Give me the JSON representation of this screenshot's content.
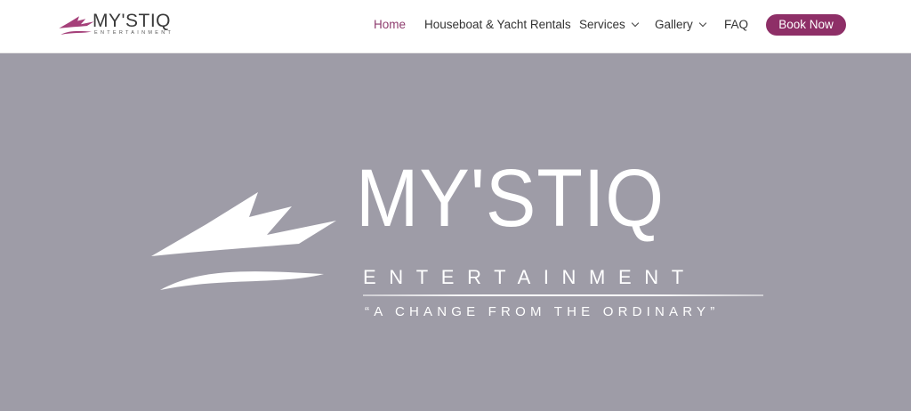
{
  "header": {
    "logo": {
      "name": "MY'STIQ",
      "sub": "ENTERTAINMENT",
      "icon": "yacht-logo-icon",
      "color": "#a5407a"
    },
    "nav": {
      "items": [
        {
          "label": "Home",
          "active": true
        },
        {
          "label": "Houseboat & Yacht Rentals"
        },
        {
          "label": "Services",
          "dropdown": true
        },
        {
          "label": "Gallery",
          "dropdown": true
        },
        {
          "label": "FAQ"
        }
      ],
      "active_color": "#8e3c6e"
    },
    "cta": {
      "label": "Book Now",
      "color": "#8e2f67"
    }
  },
  "hero": {
    "background": "#9e9ca7",
    "title": "MY'STIQ",
    "subtitle": "ENTERTAINMENT",
    "tagline": "“A CHANGE FROM THE ORDINARY”",
    "icon": "yacht-icon"
  }
}
